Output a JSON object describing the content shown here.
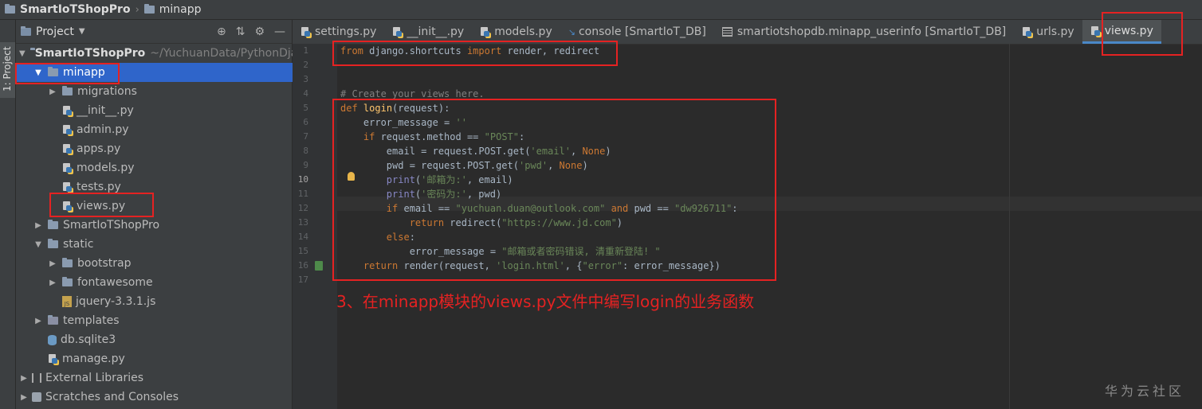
{
  "breadcrumb": {
    "project": "SmartIoTShopPro",
    "folder": "minapp"
  },
  "sidebar_tab": "1: Project",
  "project_panel": {
    "title": "Project",
    "tree": [
      {
        "label": "SmartIoTShopPro",
        "extra": "~/YuchuanData/PythonDjan",
        "type": "folder"
      },
      {
        "label": "minapp",
        "type": "folder",
        "selected": true
      },
      {
        "label": "migrations",
        "type": "folder"
      },
      {
        "label": "__init__.py",
        "type": "py"
      },
      {
        "label": "admin.py",
        "type": "py"
      },
      {
        "label": "apps.py",
        "type": "py"
      },
      {
        "label": "models.py",
        "type": "py"
      },
      {
        "label": "tests.py",
        "type": "py"
      },
      {
        "label": "views.py",
        "type": "py"
      },
      {
        "label": "SmartIoTShopPro",
        "type": "folder"
      },
      {
        "label": "static",
        "type": "folder"
      },
      {
        "label": "bootstrap",
        "type": "folder"
      },
      {
        "label": "fontawesome",
        "type": "folder"
      },
      {
        "label": "jquery-3.3.1.js",
        "type": "js"
      },
      {
        "label": "templates",
        "type": "folder"
      },
      {
        "label": "db.sqlite3",
        "type": "db"
      },
      {
        "label": "manage.py",
        "type": "py"
      },
      {
        "label": "External Libraries",
        "type": "lib"
      },
      {
        "label": "Scratches and Consoles",
        "type": "scratch"
      }
    ]
  },
  "tabs": [
    {
      "label": "settings.py"
    },
    {
      "label": "__init__.py"
    },
    {
      "label": "models.py"
    },
    {
      "label": "console [SmartIoT_DB]"
    },
    {
      "label": "smartiotshopdb.minapp_userinfo [SmartIoT_DB]"
    },
    {
      "label": "urls.py"
    },
    {
      "label": "views.py",
      "active": true
    }
  ],
  "code": {
    "line_numbers": [
      "1",
      "2",
      "3",
      "4",
      "5",
      "6",
      "7",
      "8",
      "9",
      "10",
      "11",
      "12",
      "13",
      "14",
      "15",
      "16",
      "17"
    ],
    "current_line": "10",
    "l1": {
      "kw1": "from",
      "mod": " django.shortcuts ",
      "kw2": "import",
      "rest": " render, redirect"
    },
    "l4": "# Create your views here.",
    "l5": {
      "kw": "def",
      "fn": "login",
      "rest": "(request):"
    },
    "l6": {
      "a": "    error_message = ",
      "s": "''"
    },
    "l7": {
      "kw": "    if",
      "a": " request.method == ",
      "s": "\"POST\"",
      "b": ":"
    },
    "l8": {
      "a": "        email = request.POST.get(",
      "s": "'email'",
      "b": ", ",
      "kw": "None",
      "c": ")"
    },
    "l9": {
      "a": "        pwd = request.POST.get(",
      "s": "'pwd'",
      "b": ", ",
      "kw": "None",
      "c": ")"
    },
    "l10": {
      "bi": "        print",
      "a": "(",
      "s": "'邮箱为:'",
      "b": ", email)"
    },
    "l11": {
      "bi": "        print",
      "a": "(",
      "s": "'密码为:'",
      "b": ", pwd)"
    },
    "l12": {
      "kw": "        if",
      "a": " email == ",
      "s": "\"yuchuan.duan@outlook.com\"",
      "kw2": " and",
      "b": " pwd == ",
      "s2": "\"dw926711\"",
      "c": ":"
    },
    "l13": {
      "kw": "            return",
      "a": " redirect(",
      "s": "\"https://www.jd.com\"",
      "b": ")"
    },
    "l14": {
      "kw": "        else",
      "a": ":"
    },
    "l15": {
      "a": "            error_message = ",
      "s": "\"邮箱或者密码错误, 清重新登陆! \""
    },
    "l16": {
      "kw": "    return",
      "a": " render(request, ",
      "s": "'login.html'",
      "b": ", {",
      "s2": "\"error\"",
      "c": ": error_message})"
    }
  },
  "annotation": "3、在minapp模块的views.py文件中编写login的业务函数",
  "watermark": "华为云社区",
  "colors": {
    "highlight_box": "#e52222",
    "selection": "#2f65ca",
    "editor_bg": "#2b2b2b",
    "panel_bg": "#3c3f41"
  }
}
